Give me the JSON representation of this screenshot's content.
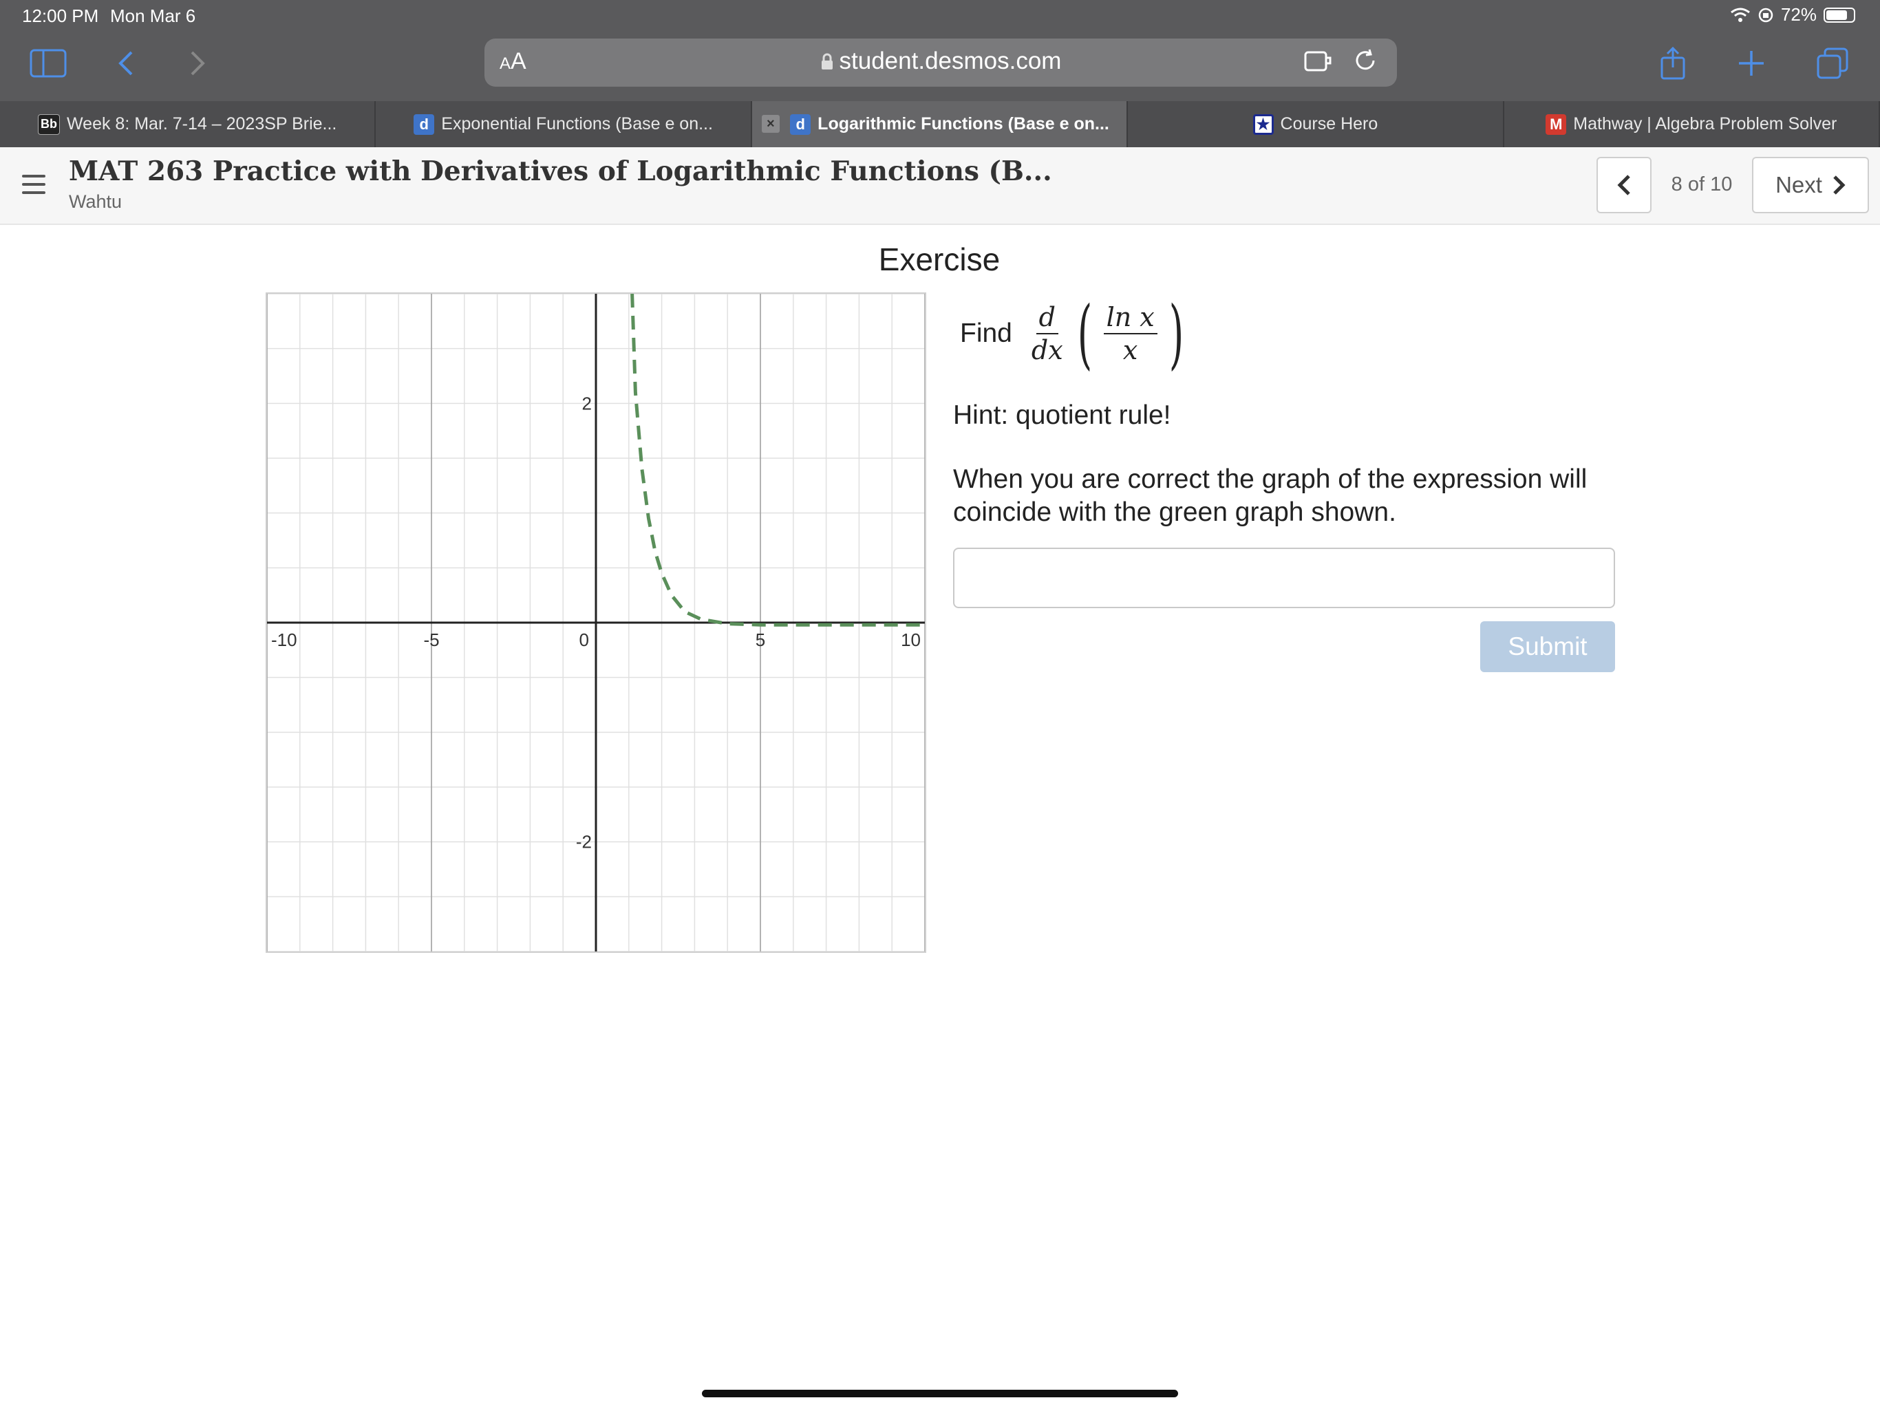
{
  "status": {
    "time": "12:00 PM",
    "date": "Mon Mar 6",
    "battery": "72%"
  },
  "browser": {
    "aa_small": "A",
    "aa_large": "A",
    "url": "student.desmos.com",
    "tabs": [
      {
        "label": "Week 8: Mar. 7-14 – 2023SP Brie...",
        "favicon": "Bb",
        "favicon_color": "#222222",
        "active": false
      },
      {
        "label": "Exponential Functions (Base e on...",
        "favicon": "d",
        "favicon_color": "#3f74c8",
        "active": false
      },
      {
        "label": "Logarithmic Functions (Base e on...",
        "favicon": "d",
        "favicon_color": "#3f74c8",
        "active": true,
        "close": "×"
      },
      {
        "label": "Course Hero",
        "favicon": "★",
        "favicon_color": "#1b2a8f",
        "active": false
      },
      {
        "label": "Mathway | Algebra Problem Solver",
        "favicon": "M",
        "favicon_color": "#d23a2f",
        "active": false
      }
    ]
  },
  "activity": {
    "title": "MAT 263 Practice with Derivatives of Logarithmic Functions (B...",
    "student": "Wahtu",
    "page_indicator": "8 of 10",
    "next_label": "Next"
  },
  "exercise": {
    "heading": "Exercise",
    "find_label": "Find",
    "deriv_num": "d",
    "deriv_den": "dx",
    "expr_num": "ln x",
    "expr_den": "x",
    "hint": "Hint: quotient rule!",
    "instructions": "When you are correct the graph of the expression will coincide with the green graph shown.",
    "answer_value": "",
    "submit_label": "Submit"
  },
  "chart_data": {
    "type": "line",
    "xlim": [
      -10,
      10
    ],
    "ylim": [
      -3,
      3
    ],
    "x_ticks": [
      "-10",
      "-5",
      "0",
      "5",
      "10"
    ],
    "y_ticks": [
      "2",
      "-2"
    ],
    "grid": true,
    "series": [
      {
        "expression": "d/dx(ln x / x)",
        "style": "dashed",
        "color": "#5a8f5a",
        "points": [
          [
            1.1,
            3.0
          ],
          [
            1.2,
            2.1
          ],
          [
            1.4,
            1.4
          ],
          [
            1.6,
            0.95
          ],
          [
            1.8,
            0.65
          ],
          [
            2.0,
            0.45
          ],
          [
            2.3,
            0.25
          ],
          [
            2.7,
            0.1
          ],
          [
            3.2,
            0.03
          ],
          [
            4.0,
            -0.01
          ],
          [
            5.0,
            -0.02
          ],
          [
            7.0,
            -0.02
          ],
          [
            10.0,
            -0.02
          ]
        ]
      }
    ],
    "colors": {
      "axis": "#222222",
      "major_grid": "#9e9e9e",
      "minor_grid": "#e0e0e0",
      "curve": "#5a8f5a"
    }
  }
}
